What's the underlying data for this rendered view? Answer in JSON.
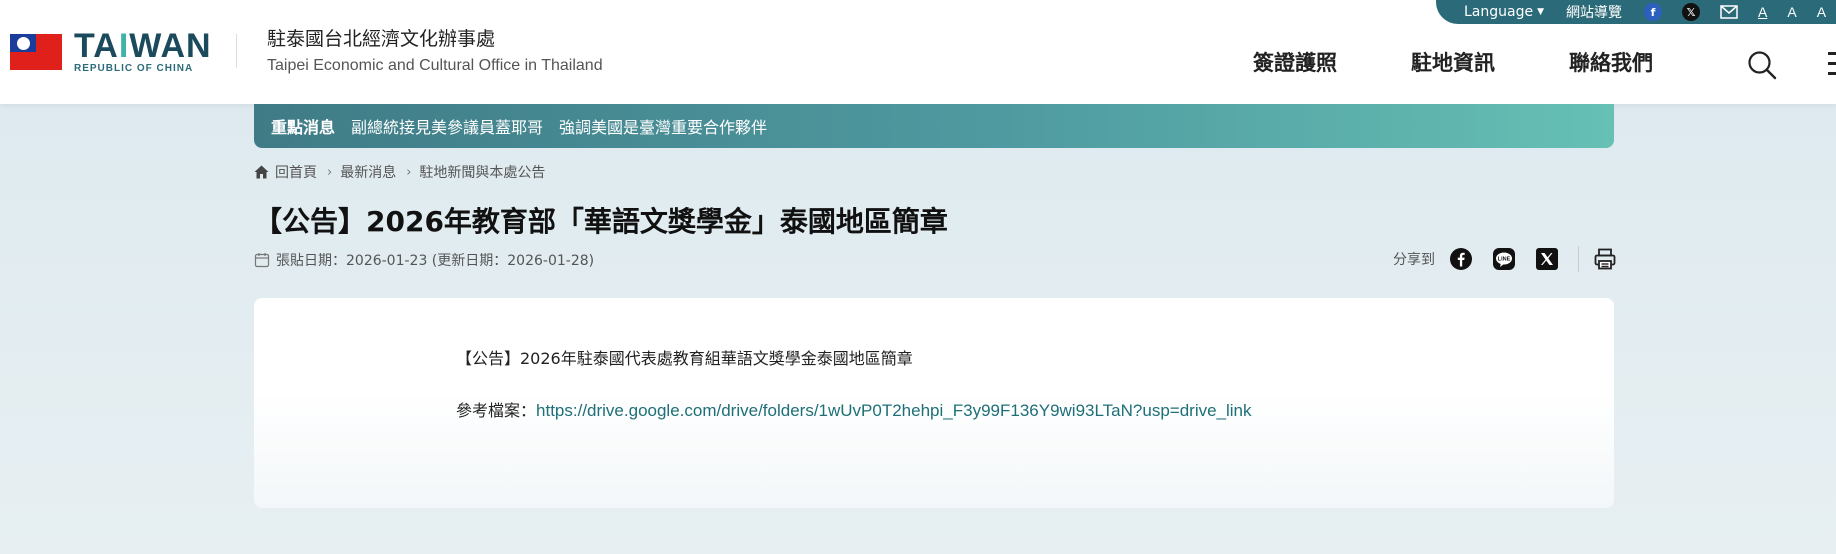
{
  "header": {
    "brand": {
      "prefix": "TA",
      "accent": "I",
      "suffix": "WAN",
      "sub": "REPUBLIC OF CHINA"
    },
    "office_cn": "駐泰國台北經濟文化辦事處",
    "office_en": "Taipei Economic and Cultural Office in Thailand"
  },
  "topbar": {
    "language": "Language",
    "sitemap": "網站導覽",
    "font_sizes": [
      "A",
      "A",
      "A"
    ]
  },
  "nav": {
    "items": [
      "簽證護照",
      "駐地資訊",
      "聯絡我們"
    ]
  },
  "marquee": {
    "label": "重點消息",
    "text": "副總統接見美參議員蓋耶哥　強調美國是臺灣重要合作夥伴"
  },
  "breadcrumb": {
    "home": "回首頁",
    "level1": "最新消息",
    "level2": "駐地新聞與本處公告"
  },
  "article": {
    "title": "【公告】2026年教育部「華語文獎學金」泰國地區簡章",
    "date_text": "張貼日期：2026-01-23 (更新日期：2026-01-28)",
    "share_label": "分享到",
    "para1": "【公告】2026年駐泰國代表處教育組華語文獎學金泰國地區簡章",
    "ref_label": "參考檔案：",
    "ref_link": "https://drive.google.com/drive/folders/1wUvP0T2hehpi_F3y99F136Y9wi93LTaN?usp=drive_link"
  },
  "colors": {
    "primary": "#2b6a78",
    "accent": "#3fb3a8",
    "link": "#1e6f78"
  }
}
